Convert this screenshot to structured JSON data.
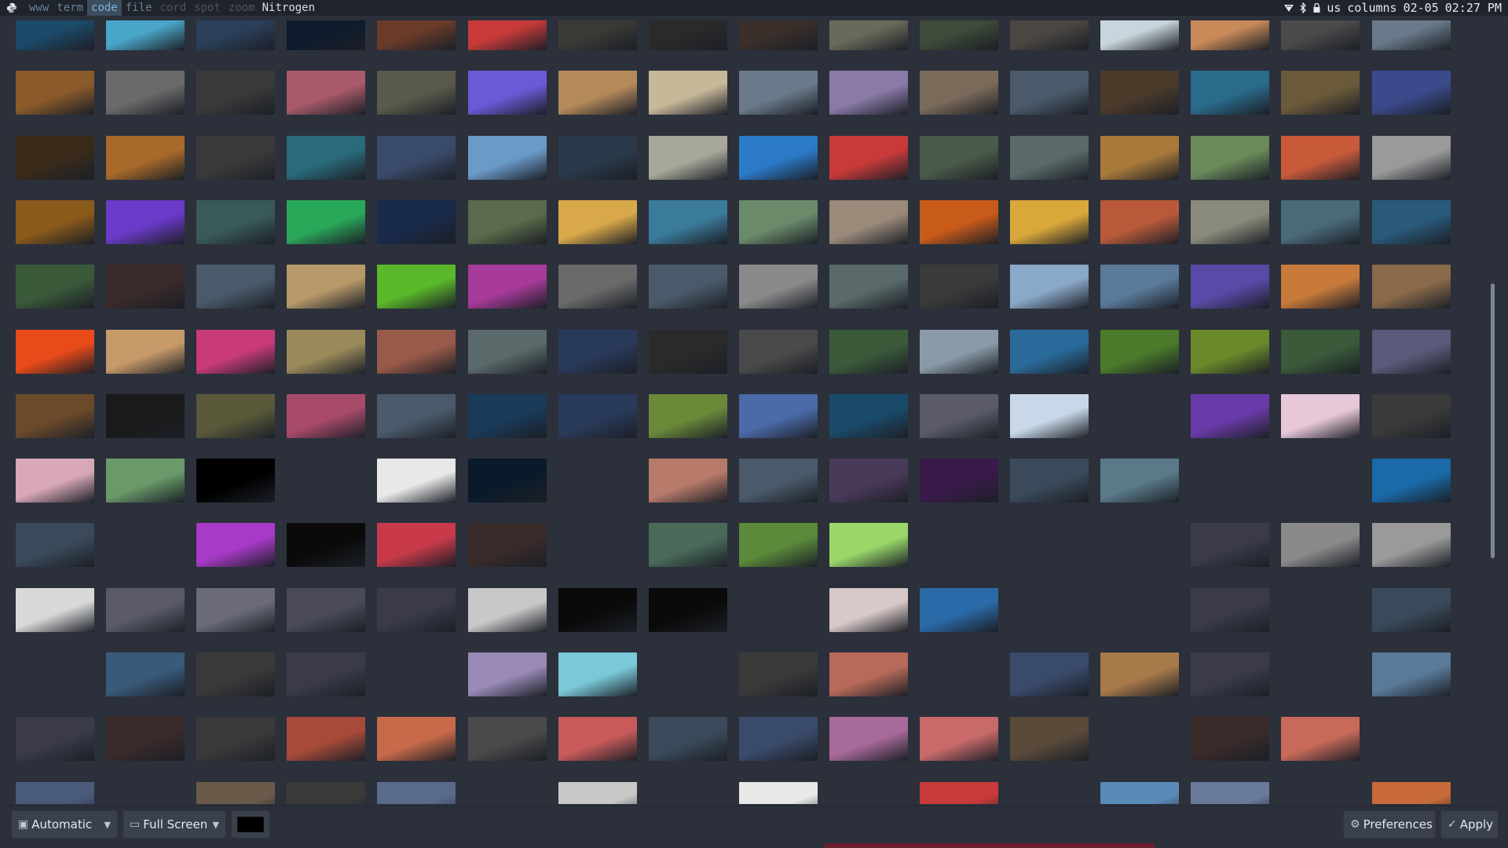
{
  "topbar": {
    "workspaces": [
      {
        "label": "www",
        "state": "occupied"
      },
      {
        "label": "term",
        "state": "occupied"
      },
      {
        "label": "code",
        "state": "active"
      },
      {
        "label": "file",
        "state": "occupied"
      },
      {
        "label": "cord",
        "state": "empty"
      },
      {
        "label": "spot",
        "state": "empty"
      },
      {
        "label": "zoom",
        "state": "empty"
      }
    ],
    "window_title": "Nitrogen",
    "tray": {
      "wifi_icon": "wifi-icon",
      "bluetooth_icon": "bluetooth-icon",
      "lock_icon": "lock-icon",
      "keyboard_layout": "us",
      "layout_mode": "columns",
      "date": "02-05",
      "time": "02:27 PM"
    }
  },
  "toolbar": {
    "mode_select": {
      "value": "Automatic",
      "icon": "monitor-icon"
    },
    "screen_select": {
      "value": "Full Screen",
      "icon": "screen-icon"
    },
    "color_swatch": "#000000",
    "preferences_label": "Preferences",
    "apply_label": "Apply"
  },
  "thumbnail_grid": {
    "columns": 16,
    "rows": [
      [
        "#1c4a6a",
        "#4aa6c9",
        "#2a3f5a",
        "#0d1a2c",
        "#6b3b2a",
        "#c83a3a",
        "#3b3a36",
        "#2a2a2a",
        "#3a2f2a",
        "#6a6a5a",
        "#3e4a3a",
        "#4a4642",
        "#c9d5dc",
        "#c98a5a",
        "#4a4a4a",
        "#6a7a8a"
      ],
      [
        "#8a5a2a",
        "#6a6a6a",
        "#3a3a3a",
        "#a85a6a",
        "#5a5a4a",
        "#6a5ad8",
        "#b58a5a",
        "#c8b89a",
        "#6a7a8a",
        "#8a7aa8",
        "#7a6a5a",
        "#4a5a6a",
        "#4a3a2a",
        "#2a6a8a",
        "#6a5a3a",
        "#3a4a8a"
      ],
      [
        "#3a2a1a",
        "#a86a2a",
        "#3a3a3a",
        "#2a6a7a",
        "#3a4a6a",
        "#6a9ac8",
        "#2a3a4a",
        "#a8a89a",
        "#2a7ac8",
        "#c83a3a",
        "#4a5a4a",
        "#5a6a6a",
        "#a87a3a",
        "#6a8a5a",
        "#c85a3a",
        "#9a9a9a"
      ],
      [
        "#8a5a1a",
        "#6a3ac8",
        "#3a5a5a",
        "#2aa85a",
        "#1a2a4a",
        "#5a6a4a",
        "#d8a84a",
        "#3a7a9a",
        "#6a8a6a",
        "#9a8a7a",
        "#c85a1a",
        "#d8a83a",
        "#b85a3a",
        "#8a8a7a",
        "#4a6a7a",
        "#2a5a7a"
      ],
      [
        "#3a5a3a",
        "#3a2a2a",
        "#4a5a6a",
        "#b89a6a",
        "#5ab82a",
        "#a83a9a",
        "#6a6a6a",
        "#4a5a6a",
        "#8a8a8a",
        "#5a6a6a",
        "#3a3a3a",
        "#8aa8c8",
        "#5a7a9a",
        "#5a4aa8",
        "#c87a3a",
        "#8a6a4a"
      ],
      [
        "#e84a1a",
        "#c89a6a",
        "#c83a7a",
        "#9a8a5a",
        "#9a5a4a",
        "#5a6a6a",
        "#2a3a5a",
        "#2a2a2a",
        "#4a4a4a",
        "#3a5a3a",
        "#8a9aa8",
        "#2a6a9a",
        "#4a7a2a",
        "#6a8a2a",
        "#3a5a3a",
        "#5a5a7a"
      ],
      [
        "#6a4a2a",
        "#1a1a1a",
        "#5a5a3a",
        "#a84a6a",
        "#4a5a6a",
        "#1a3a5a",
        "#2a3a5a",
        "#6a8a3a",
        "#4a6aa8",
        "#1a4a6a",
        "#5a5a6a",
        "#c8d8e8",
        "#2b303b",
        "#6a3aa8",
        "#e8c8d8",
        "#3a3a3a"
      ],
      [
        "#d8a8b8",
        "#6a9a6a",
        "#000000",
        "#2b303b",
        "#e8e8e8",
        "#0a1a2a",
        "#2b303b",
        "#b87a6a",
        "#4a5a6a",
        "#4a3a5a",
        "#3a1a4a",
        "#3a4a5a",
        "#5a7a8a",
        "#2b303b",
        "#2b303b",
        "#1a6aa8"
      ],
      [
        "#3a4a5a",
        "#2b303b",
        "#a83ac8",
        "#0a0a0a",
        "#c83a4a",
        "#3a2b2b",
        "#2b303b",
        "#4a6a5a",
        "#5a8a3a",
        "#9ad86a",
        "#2b303b",
        "#2b303b",
        "#2b303b",
        "#3a3a4a",
        "#8a8a8a",
        "#9a9a9a"
      ],
      [
        "#d8d8d8",
        "#5a5a6a",
        "#6a6a7a",
        "#4a4a5a",
        "#3a3a4a",
        "#c8c8c8",
        "#0a0a0a",
        "#0a0a0a",
        "#2b303b",
        "#d8c8c8",
        "#2a6aa8",
        "#2b303b",
        "#2b303b",
        "#3a3a4a",
        "#2b303b",
        "#3a4a5a"
      ],
      [
        "#2b303b",
        "#3a5a7a",
        "#3a3a3a",
        "#3a3a4a",
        "#2b303b",
        "#9a8ab8",
        "#7ac8d8",
        "#2b303b",
        "#3a3a3a",
        "#b86a5a",
        "#2b303b",
        "#3a4a6a",
        "#a87a4a",
        "#3a3a4a",
        "#2b303b",
        "#5a7a9a"
      ],
      [
        "#3a3a4a",
        "#3a2a2a",
        "#3a3a3a",
        "#a84a3a",
        "#c86a4a",
        "#4a4a4a",
        "#c85a5a",
        "#3a4a5a",
        "#3a4a6a",
        "#a86a9a",
        "#c86a6a",
        "#5a4a3a",
        "#2b303b",
        "#3a2a2a",
        "#c86a5a",
        "#2b303b"
      ],
      [
        "#4a5a7a",
        "#2b303b",
        "#6a5a4a",
        "#3a3a3a",
        "#5a6a8a",
        "#2b303b",
        "#c8c8c8",
        "#2b303b",
        "#e8e8e8",
        "#2b303b",
        "#c83a3a",
        "#2b303b",
        "#5a8ab8",
        "#6a7a9a",
        "#2b303b",
        "#c86a3a"
      ]
    ]
  }
}
